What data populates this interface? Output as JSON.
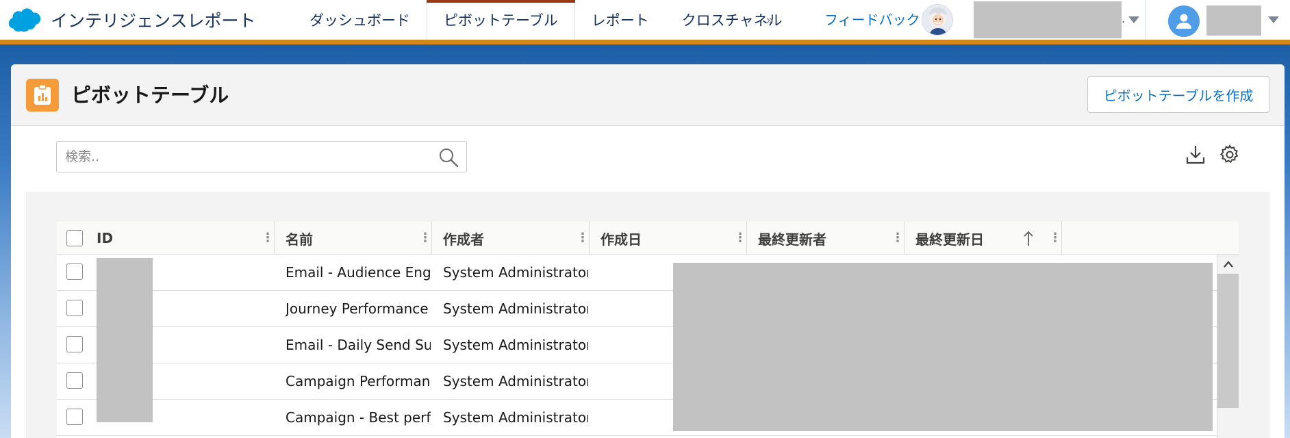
{
  "app": {
    "title": "インテリジェンスレポート"
  },
  "nav": {
    "items": [
      {
        "label": "ダッシュボード",
        "active": false
      },
      {
        "label": "ピボットテーブル",
        "active": true
      },
      {
        "label": "レポート",
        "active": false
      },
      {
        "label": "クロスチャネル",
        "active": false
      }
    ],
    "more_glyph": "»",
    "feedback_label": "フィードバック",
    "org_suffix": "."
  },
  "page": {
    "title": "ピボットテーブル",
    "create_button_label": "ピボットテーブルを作成"
  },
  "search": {
    "placeholder": "検索.."
  },
  "table": {
    "columns": [
      {
        "label": "ID"
      },
      {
        "label": "名前"
      },
      {
        "label": "作成者"
      },
      {
        "label": "作成日"
      },
      {
        "label": "最終更新者"
      },
      {
        "label": "最終更新日",
        "sorted": "ascending"
      }
    ],
    "rows": [
      {
        "name": "Email - Audience Engag...",
        "created_by": "System Administrator"
      },
      {
        "name": "Journey Performance",
        "created_by": "System Administrator"
      },
      {
        "name": "Email - Daily Send Sum...",
        "created_by": "System Administrator"
      },
      {
        "name": "Campaign Performance",
        "created_by": "System Administrator"
      },
      {
        "name": "Campaign - Best perfor...",
        "created_by": "System Administrator"
      }
    ]
  },
  "colors": {
    "nav_accent": "#d4861b",
    "active_tab_bar": "#9b3a12",
    "link_blue": "#0a6fc2",
    "header_icon_bg": "#f59b3a",
    "avatar_blue": "#4e9de6",
    "redaction_gray": "#c2c2c2"
  },
  "icons": {
    "brand": "salesforce-cloud-icon",
    "header": "clipboard-chart-icon",
    "search": "search-icon",
    "download": "download-icon",
    "settings": "gear-icon",
    "sort": "arrow-up-icon",
    "column_menu": "vertical-dots-icon",
    "user": "user-icon"
  }
}
